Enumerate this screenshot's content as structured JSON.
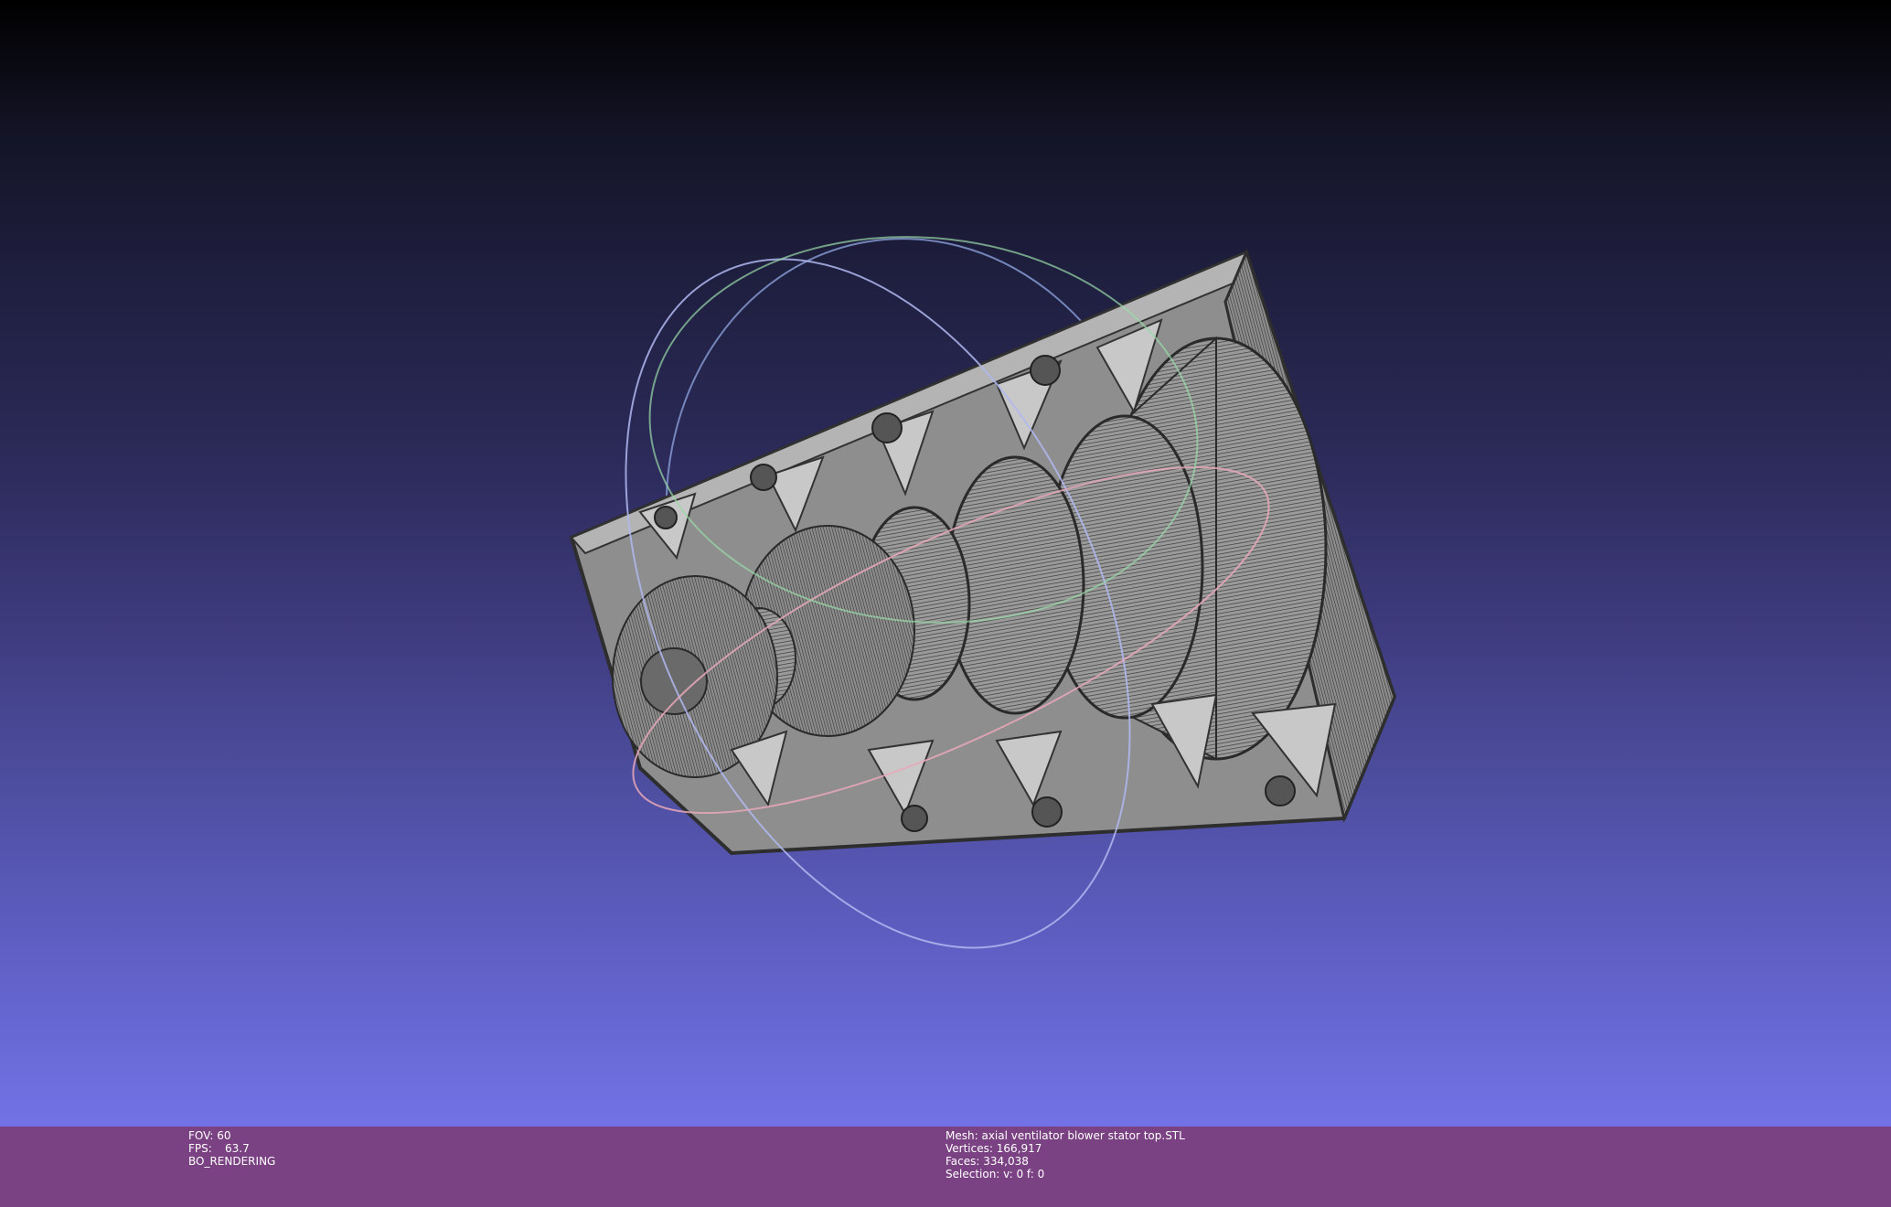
{
  "viewer": {
    "background_top": "#000000",
    "background_bottom": "#7272e6",
    "info_bar_color": "#7b4283",
    "trackball_colors": {
      "x_ring": "#e8a0b0",
      "y_ring": "#90e0a0",
      "z_ring": "#a0a8ff"
    },
    "model": {
      "name": "axial ventilator blower stator top.STL",
      "color": "#a8a8a8",
      "edge_color": "#3a3a3a"
    }
  },
  "info_left": {
    "fov_label": "FOV:",
    "fov_value": "60",
    "fps_label": "FPS:",
    "fps_value": "63.7",
    "render_mode": "BO_RENDERING"
  },
  "info_right": {
    "mesh_label": "Mesh:",
    "mesh_name": "axial ventilator blower stator top.STL",
    "vertices_label": "Vertices:",
    "vertices_value": "166,917",
    "faces_label": "Faces:",
    "faces_value": "334,038",
    "selection_label": "Selection:",
    "selection_value": "v: 0 f: 0"
  }
}
